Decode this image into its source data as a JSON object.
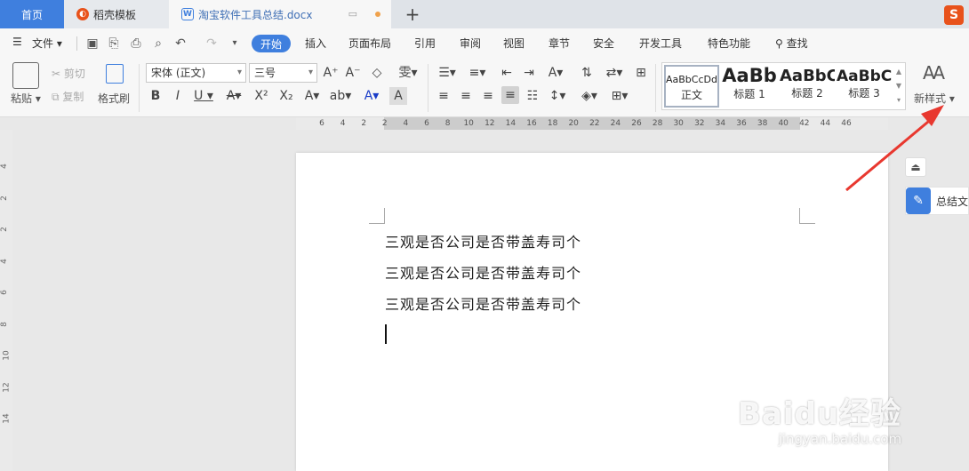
{
  "tabs": {
    "home": "首页",
    "template": "稻壳模板",
    "document": "淘宝软件工具总结.docx"
  },
  "menu": {
    "file": "文件",
    "start": "开始",
    "insert": "插入",
    "layout": "页面布局",
    "reference": "引用",
    "review": "审阅",
    "view": "视图",
    "chapter": "章节",
    "security": "安全",
    "developer": "开发工具",
    "special": "特色功能",
    "search": "查找"
  },
  "ribbon": {
    "paste": "粘贴",
    "cut": "剪切",
    "copy": "复制",
    "format_painter": "格式刷",
    "font_name": "宋体 (正文)",
    "font_size": "三号",
    "new_style": "新样式",
    "styles": [
      {
        "sample": "AaBbCcDd",
        "name": "正文"
      },
      {
        "sample": "AaBb",
        "name": "标题 1"
      },
      {
        "sample": "AaBbC",
        "name": "标题 2"
      },
      {
        "sample": "AaBbC",
        "name": "标题 3"
      }
    ]
  },
  "ruler": {
    "h_ticks": [
      "6",
      "4",
      "2",
      "2",
      "4",
      "6",
      "8",
      "10",
      "12",
      "14",
      "16",
      "18",
      "20",
      "22",
      "24",
      "26",
      "28",
      "30",
      "32",
      "34",
      "36",
      "38",
      "40",
      "42",
      "44",
      "46"
    ],
    "v_ticks": [
      "4",
      "2",
      "2",
      "4",
      "6",
      "8",
      "10",
      "12",
      "14"
    ]
  },
  "document": {
    "lines": [
      "三观是否公司是否带盖寿司个",
      "三观是否公司是否带盖寿司个",
      "三观是否公司是否带盖寿司个"
    ]
  },
  "side_panel": {
    "summary": "总结文"
  },
  "watermark": {
    "logo": "Baidu经验",
    "url": "jingyan.baidu.com"
  },
  "colors": {
    "accent": "#3f7fde",
    "arrow": "#e8382f"
  }
}
